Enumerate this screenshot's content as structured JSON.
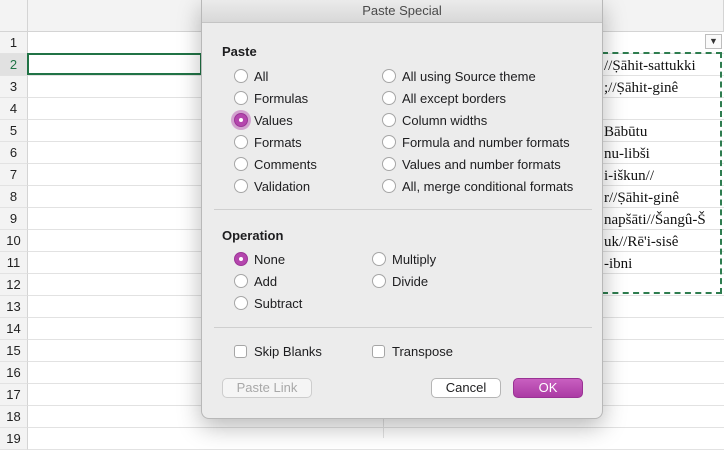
{
  "dialog": {
    "title": "Paste Special",
    "paste": {
      "heading": "Paste",
      "left": [
        "All",
        "Formulas",
        "Values",
        "Formats",
        "Comments",
        "Validation"
      ],
      "right": [
        "All using Source theme",
        "All except borders",
        "Column widths",
        "Formula and number formats",
        "Values and number formats",
        "All, merge conditional formats"
      ],
      "selected": "Values"
    },
    "operation": {
      "heading": "Operation",
      "left": [
        "None",
        "Add",
        "Subtract"
      ],
      "right": [
        "Multiply",
        "Divide"
      ],
      "selected": "None"
    },
    "skip_blanks": "Skip Blanks",
    "transpose": "Transpose",
    "paste_link": "Paste Link",
    "cancel": "Cancel",
    "ok": "OK"
  },
  "sheet": {
    "rows": [
      "1",
      "2",
      "3",
      "4",
      "5",
      "6",
      "7",
      "8",
      "9",
      "10",
      "11",
      "12",
      "13",
      "14",
      "15",
      "16",
      "17",
      "18",
      "19"
    ],
    "active_row": "2",
    "filter_icon": "filter-dropdown-icon",
    "cells": [
      {
        "row": "2",
        "text": "//Ṣāhit-sattukki"
      },
      {
        "row": "3",
        "text": ";//Ṣāhit-ginê"
      },
      {
        "row": "5",
        "text": "Bābūtu"
      },
      {
        "row": "6",
        "text": "nu-libši"
      },
      {
        "row": "7",
        "text": "i-iškun//"
      },
      {
        "row": "8",
        "text": "r//Ṣāhit-ginê"
      },
      {
        "row": "9",
        "text": "napšāti//Šangû-Š"
      },
      {
        "row": "10",
        "text": "uk//Rē'i-sisê"
      },
      {
        "row": "11",
        "text": "-ibni"
      }
    ]
  },
  "colors": {
    "accent": "#b446ad",
    "selection": "#217346"
  }
}
